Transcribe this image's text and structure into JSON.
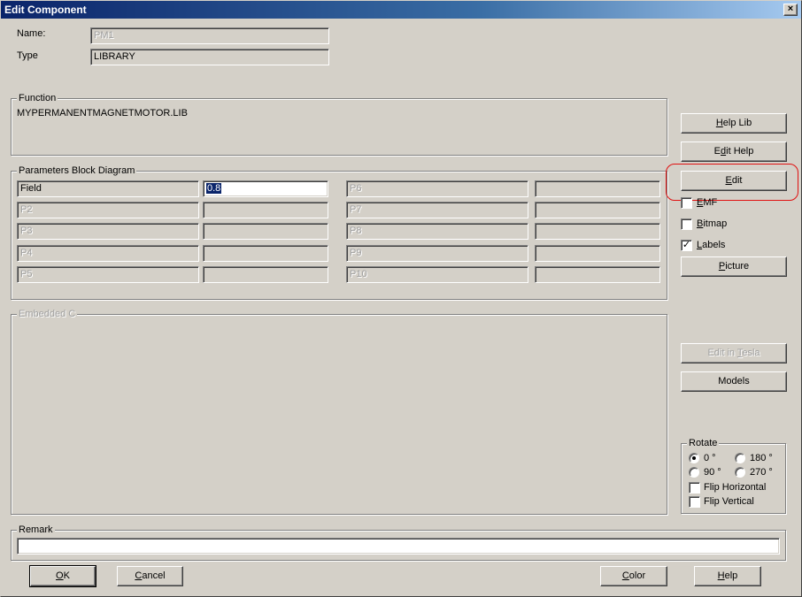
{
  "window": {
    "title": "Edit Component",
    "close_glyph": "×"
  },
  "header": {
    "name_label": "Name:",
    "name_value": "PM1",
    "type_label": "Type",
    "type_value": "LIBRARY"
  },
  "function_group": {
    "title": "Function",
    "value": "MYPERMANENTMAGNETMOTOR.LIB"
  },
  "parameters_group": {
    "title": "Parameters Block Diagram",
    "left": [
      {
        "name": "Field",
        "value": "0.8"
      },
      {
        "name": "P2",
        "value": ""
      },
      {
        "name": "P3",
        "value": ""
      },
      {
        "name": "P4",
        "value": ""
      },
      {
        "name": "P5",
        "value": ""
      }
    ],
    "right": [
      {
        "name": "P6",
        "value": ""
      },
      {
        "name": "P7",
        "value": ""
      },
      {
        "name": "P8",
        "value": ""
      },
      {
        "name": "P9",
        "value": ""
      },
      {
        "name": "P10",
        "value": ""
      }
    ]
  },
  "embedded_group": {
    "title": "Embedded C"
  },
  "side_panel": {
    "help_lib": {
      "prefix": "",
      "accel": "H",
      "rest": "elp Lib"
    },
    "edit_help": {
      "prefix": "E",
      "accel": "d",
      "rest": "it Help"
    },
    "edit": {
      "prefix": "",
      "accel": "E",
      "rest": "dit"
    },
    "emf": {
      "prefix": "",
      "accel": "E",
      "rest": "MF",
      "checked": false
    },
    "bitmap": {
      "prefix": "",
      "accel": "B",
      "rest": "itmap",
      "checked": false
    },
    "labels": {
      "prefix": "",
      "accel": "L",
      "rest": "abels",
      "checked": true,
      "check_glyph": "✓"
    },
    "picture": {
      "prefix": "",
      "accel": "P",
      "rest": "icture"
    },
    "edit_in_tesla": {
      "prefix": "Edit in ",
      "accel": "T",
      "rest": "esla"
    },
    "models": "Models"
  },
  "rotate_group": {
    "title": "Rotate",
    "options": [
      "0 °",
      "180 °",
      "90 °",
      "270 °"
    ],
    "selected": "0 °",
    "flip_horizontal": "Flip Horizontal",
    "flip_vertical": "Flip Vertical"
  },
  "remark_group": {
    "title": "Remark",
    "value": ""
  },
  "footer": {
    "ok": {
      "accel": "O",
      "rest": "K"
    },
    "cancel": {
      "accel": "C",
      "rest": "ancel"
    },
    "color": {
      "accel": "C",
      "rest": "olor"
    },
    "help": {
      "accel": "H",
      "rest": "elp"
    }
  },
  "colors": {
    "face": "#d4d0c8",
    "title_start": "#0a246a",
    "title_end": "#a6caf0",
    "highlight_ring": "#e01010",
    "disabled_text": "#a0a0a0"
  }
}
